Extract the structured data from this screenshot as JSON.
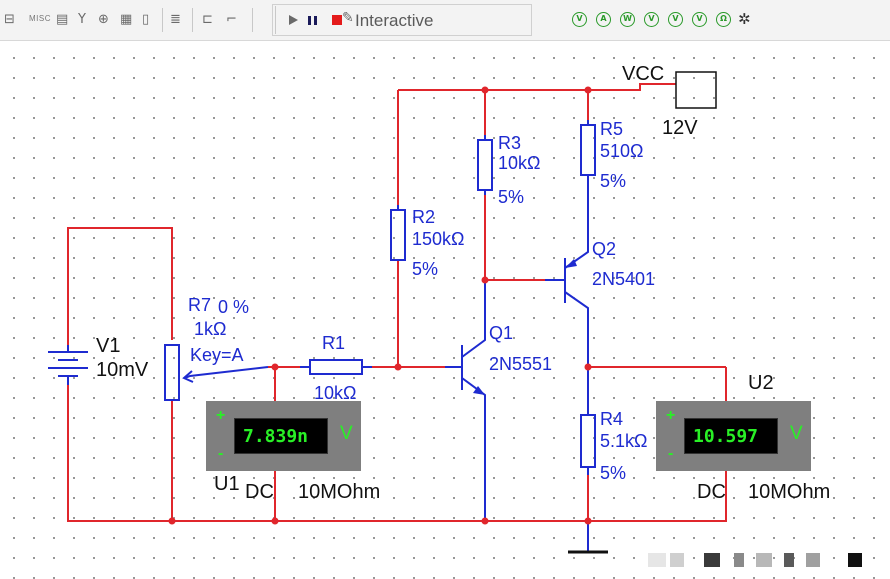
{
  "toolbar": {
    "misc_label": "MISC",
    "mode_label": "Interactive",
    "analysis_icons": [
      "V",
      "A",
      "W",
      "V",
      "V",
      "V",
      "Ω"
    ]
  },
  "components": {
    "v1": {
      "ref": "V1",
      "value": "10mV"
    },
    "r7": {
      "ref": "R7",
      "percent": "0 %",
      "value": "1kΩ",
      "key": "Key=A"
    },
    "r1": {
      "ref": "R1",
      "value": "10kΩ"
    },
    "r2": {
      "ref": "R2",
      "value": "150kΩ",
      "tol": "5%"
    },
    "r3": {
      "ref": "R3",
      "value": "10kΩ",
      "tol": "5%"
    },
    "r5": {
      "ref": "R5",
      "value": "510Ω",
      "tol": "5%"
    },
    "r4": {
      "ref": "R4",
      "value": "5.1kΩ",
      "tol": "5%"
    },
    "q1": {
      "ref": "Q1",
      "model": "2N5551"
    },
    "q2": {
      "ref": "Q2",
      "model": "2N5401"
    },
    "vcc": {
      "label": "VCC",
      "value": "12V"
    }
  },
  "meters": {
    "u1": {
      "ref": "U1",
      "reading": "7.839n",
      "unit": "V",
      "mode": "DC",
      "resistance": "10MOhm",
      "plus": "+",
      "minus": "-"
    },
    "u2": {
      "ref": "U2",
      "reading": "10.597",
      "unit": "V",
      "mode": "DC",
      "resistance": "10MOhm",
      "plus": "+",
      "minus": "-"
    }
  },
  "colors": {
    "wire": "#e0262c",
    "component": "#1e2bd0",
    "meter_body": "#7f7f7f",
    "meter_text": "#29f026",
    "junction": "#e0262c"
  }
}
